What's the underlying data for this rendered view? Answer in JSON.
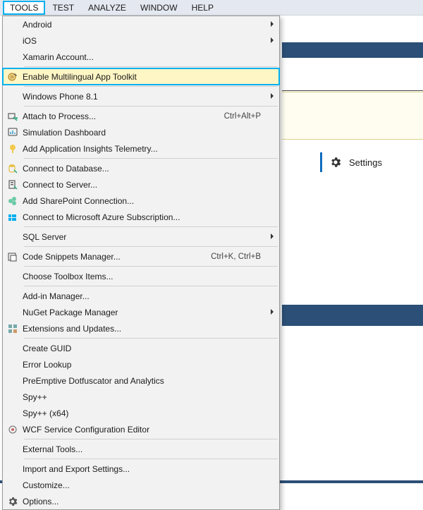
{
  "menubar": {
    "items": [
      "TOOLS",
      "TEST",
      "ANALYZE",
      "WINDOW",
      "HELP"
    ],
    "active_index": 0
  },
  "background": {
    "settings_label": "Settings"
  },
  "menu": {
    "groups": [
      [
        {
          "label": "Android",
          "submenu": true
        },
        {
          "label": "iOS",
          "submenu": true
        },
        {
          "label": "Xamarin Account..."
        }
      ],
      [
        {
          "label": "Enable Multilingual App Toolkit",
          "icon": "globe-wand",
          "highlight": true
        }
      ],
      [
        {
          "label": "Windows Phone 8.1",
          "submenu": true
        }
      ],
      [
        {
          "label": "Attach to Process...",
          "icon": "attach-process",
          "shortcut": "Ctrl+Alt+P"
        },
        {
          "label": "Simulation Dashboard",
          "icon": "sim-dashboard"
        },
        {
          "label": "Add Application Insights Telemetry...",
          "icon": "app-insights"
        }
      ],
      [
        {
          "label": "Connect to Database...",
          "icon": "connect-db"
        },
        {
          "label": "Connect to Server...",
          "icon": "connect-server"
        },
        {
          "label": "Add SharePoint Connection...",
          "icon": "sharepoint"
        },
        {
          "label": "Connect to Microsoft Azure Subscription...",
          "icon": "azure"
        }
      ],
      [
        {
          "label": "SQL Server",
          "submenu": true
        }
      ],
      [
        {
          "label": "Code Snippets Manager...",
          "icon": "snippets",
          "shortcut": "Ctrl+K, Ctrl+B"
        }
      ],
      [
        {
          "label": "Choose Toolbox Items..."
        }
      ],
      [
        {
          "label": "Add-in Manager..."
        },
        {
          "label": "NuGet Package Manager",
          "submenu": true
        },
        {
          "label": "Extensions and Updates...",
          "icon": "extensions"
        }
      ],
      [
        {
          "label": "Create GUID"
        },
        {
          "label": "Error Lookup"
        },
        {
          "label": "PreEmptive Dotfuscator and Analytics"
        },
        {
          "label": "Spy++"
        },
        {
          "label": "Spy++  (x64)"
        },
        {
          "label": "WCF Service Configuration Editor",
          "icon": "wcf"
        }
      ],
      [
        {
          "label": "External Tools..."
        }
      ],
      [
        {
          "label": "Import and Export Settings..."
        },
        {
          "label": "Customize..."
        },
        {
          "label": "Options...",
          "icon": "options-gear"
        }
      ]
    ]
  }
}
